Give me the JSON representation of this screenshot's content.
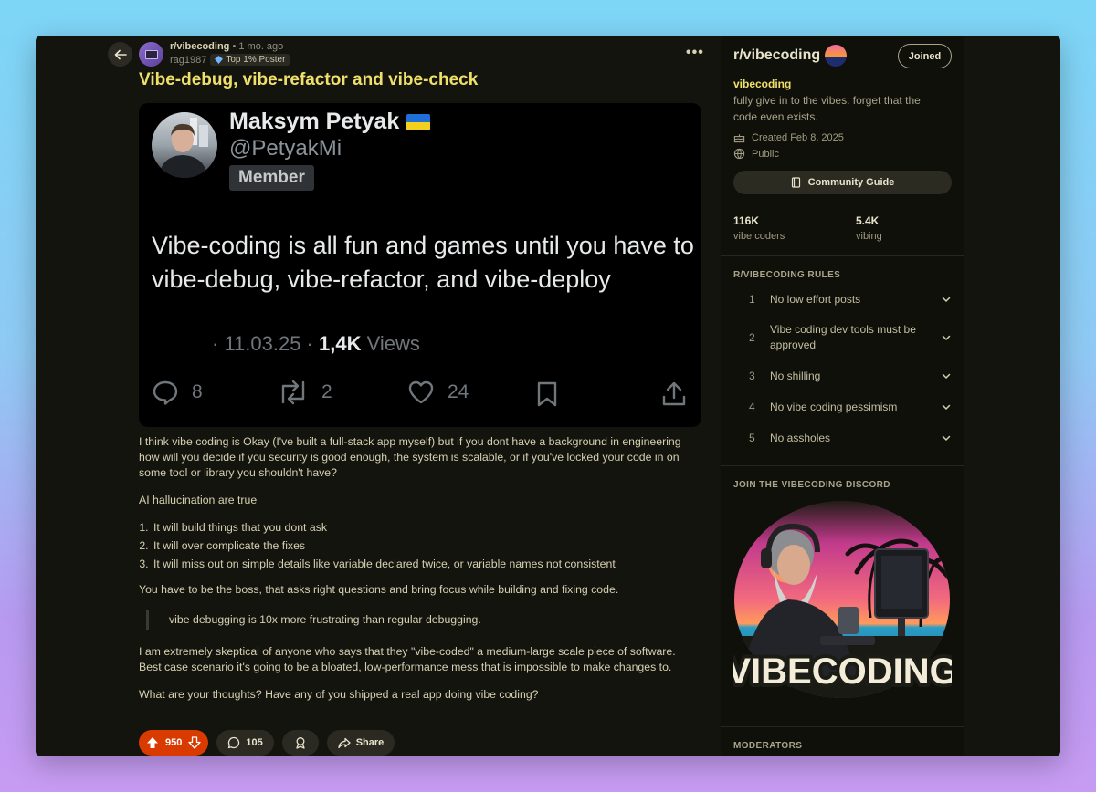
{
  "post": {
    "subreddit": "r/vibecoding",
    "age": " • 1 mo. ago",
    "author": "rag1987",
    "flair": "Top 1% Poster",
    "title": "Vibe-debug, vibe-refactor and vibe-check",
    "more_label": "•••"
  },
  "tweet": {
    "name": "Maksym Petyak",
    "handle": "@PetyakMi",
    "badge": "Member",
    "text": "Vibe-coding is all fun and games until you have to vibe-debug, vibe-refactor, and vibe-deploy",
    "date": "· 11.03.25 · ",
    "views_count": "1,4K",
    "views_label": " Views",
    "replies": "8",
    "retweets": "2",
    "likes": "24"
  },
  "body": {
    "p1": "I think vibe coding is Okay (I've built a full-stack app myself) but if you dont have a background in engineering how will you decide if you security is good enough, the system is scalable, or if you've locked your code in on some tool or library you shouldn't have?",
    "p2": "AI hallucination are true",
    "list": [
      "It will build things that you dont ask",
      "It will over complicate the fixes",
      "It will miss out on simple details like variable declared twice, or variable names not consistent"
    ],
    "p3": "You have to be the boss, that asks right questions and bring focus while building and fixing code.",
    "quote": "vibe debugging is 10x more frustrating than regular debugging.",
    "p4": "I am extremely skeptical of anyone who says that they \"vibe-coded\" a medium-large scale piece of software. Best case scenario it's going to be a bloated, low-performance mess that is impossible to make changes to.",
    "p5": "What are your thoughts? Have any of you shipped a real app doing vibe coding?"
  },
  "actions": {
    "votes": "950",
    "comments": "105",
    "share": "Share",
    "vote_color": "#d93a00"
  },
  "sidebar": {
    "title": "r/vibecoding",
    "joined": "Joined",
    "name": "vibecoding",
    "description": "fully give in to the vibes. forget that the code even exists.",
    "created": "Created Feb 8, 2025",
    "visibility": "Public",
    "guide": "Community Guide",
    "stats": [
      {
        "value": "116K",
        "label": "vibe coders"
      },
      {
        "value": "5.4K",
        "label": "vibing"
      }
    ],
    "rules_title": "R/VIBECODING RULES",
    "rules": [
      {
        "num": "1",
        "text": "No low effort posts"
      },
      {
        "num": "2",
        "text": "Vibe coding dev tools must be approved"
      },
      {
        "num": "3",
        "text": "No shilling"
      },
      {
        "num": "4",
        "text": "No vibe coding pessimism"
      },
      {
        "num": "5",
        "text": "No assholes"
      }
    ],
    "discord_title": "JOIN THE VIBECODING DISCORD",
    "discord_art_text": "VIBECODING",
    "moderators_title": "MODERATORS"
  },
  "colors": {
    "accent_title": "#efe06a",
    "background": "#14140e",
    "sidebar_bg": "#10100b"
  },
  "icons": [
    "back-arrow-icon",
    "more-icon",
    "reply-icon",
    "retweet-icon",
    "like-icon",
    "bookmark-icon",
    "share-upload-icon",
    "upvote-icon",
    "downvote-icon",
    "comment-icon",
    "award-icon",
    "share-icon",
    "cake-icon",
    "globe-icon",
    "book-icon",
    "chevron-down-icon"
  ]
}
